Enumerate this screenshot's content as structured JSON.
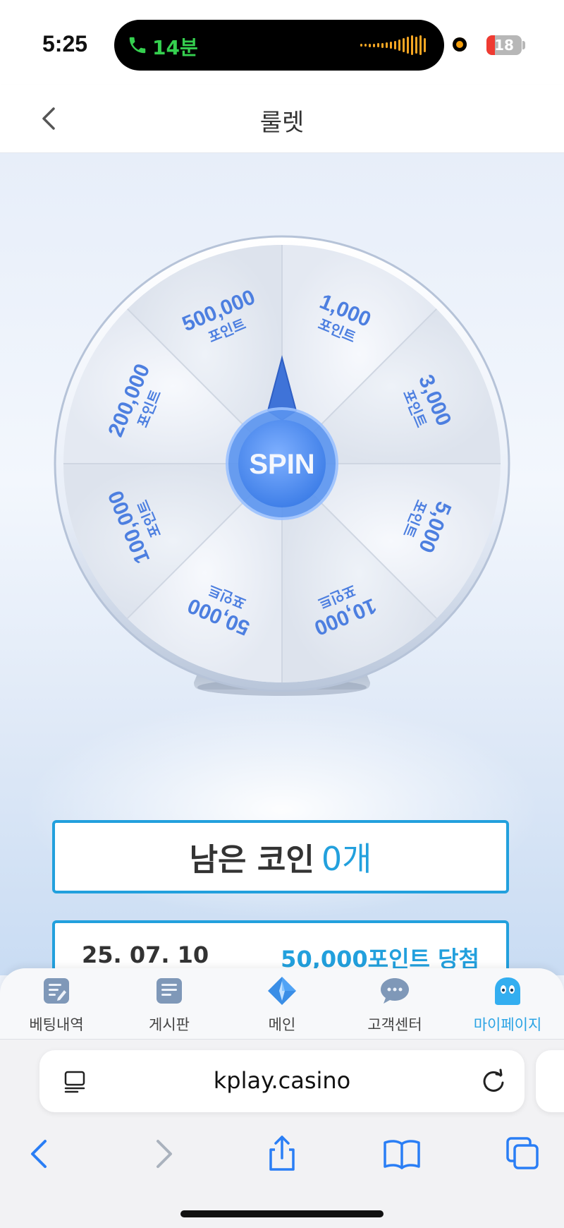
{
  "status_bar": {
    "time": "5:25",
    "call_duration": "14분",
    "battery": "18"
  },
  "header": {
    "title": "룰렛"
  },
  "wheel": {
    "center_label": "SPIN",
    "segments": [
      {
        "amount": "1,000",
        "unit": "포인트"
      },
      {
        "amount": "3,000",
        "unit": "포인트"
      },
      {
        "amount": "5,000",
        "unit": "포인트"
      },
      {
        "amount": "10,000",
        "unit": "포인트"
      },
      {
        "amount": "50,000",
        "unit": "포인트"
      },
      {
        "amount": "100,000",
        "unit": "포인트"
      },
      {
        "amount": "200,000",
        "unit": "포인트"
      },
      {
        "amount": "500,000",
        "unit": "포인트"
      }
    ],
    "colors": {
      "accent": "#4f8ff0",
      "text": "#4d7fe0"
    }
  },
  "coins": {
    "label": "남은 코인",
    "count": "0개"
  },
  "history": [
    {
      "date": "25. 07. 10",
      "prize": "50,000포인트 당첨"
    }
  ],
  "tabbar": {
    "items": [
      {
        "label": "베팅내역",
        "icon": "edit-document-icon"
      },
      {
        "label": "게시판",
        "icon": "document-icon"
      },
      {
        "label": "메인",
        "icon": "diamond-logo-icon"
      },
      {
        "label": "고객센터",
        "icon": "chat-bubble-icon"
      },
      {
        "label": "마이페이지",
        "icon": "character-face-icon"
      }
    ],
    "active": "마이페이지",
    "accent_color": "#2aa3e4"
  },
  "browser": {
    "url": "kplay.casino"
  }
}
